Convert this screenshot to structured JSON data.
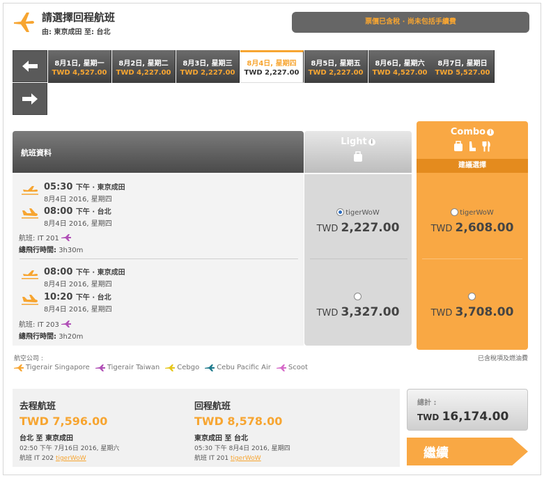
{
  "header": {
    "title": "請選擇回程航班",
    "route": "由: 東京成田 至: 台北",
    "price_note": "票價已含稅 · 尚未包括手續費"
  },
  "dates": [
    {
      "date": "8月1日, 星期一",
      "price": "TWD 4,527.00"
    },
    {
      "date": "8月2日, 星期二",
      "price": "TWD 4,227.00"
    },
    {
      "date": "8月3日, 星期三",
      "price": "TWD 2,227.00"
    },
    {
      "date": "8月4日, 星期四",
      "price": "TWD 2,227.00"
    },
    {
      "date": "8月5日, 星期五",
      "price": "TWD 2,227.00"
    },
    {
      "date": "8月6日, 星期六",
      "price": "TWD 4,527.00"
    },
    {
      "date": "8月7日, 星期日",
      "price": "TWD 5,527.00"
    }
  ],
  "table": {
    "info_header": "航班資料",
    "light_label": "Light",
    "combo_label": "Combo",
    "combo_recommend": "建議選擇",
    "info_icon": "i"
  },
  "flights": [
    {
      "dep_time": "05:30",
      "dep_ampm": "下午 · 東京成田",
      "dep_date": "8月4日 2016, 星期四",
      "arr_time": "08:00",
      "arr_ampm": "下午 · 台北",
      "arr_date": "8月4日 2016, 星期四",
      "flight_label": "航班:",
      "flight_no": "IT 201",
      "duration_label": "總飛行時間:",
      "duration": "3h30m",
      "light": {
        "tag": "tigerWoW",
        "currency": "TWD",
        "amount": "2,227.00",
        "selected": true
      },
      "combo": {
        "tag": "tigerWoW",
        "currency": "TWD",
        "amount": "2,608.00",
        "selected": false
      }
    },
    {
      "dep_time": "08:00",
      "dep_ampm": "下午 · 東京成田",
      "dep_date": "8月4日 2016, 星期四",
      "arr_time": "10:20",
      "arr_ampm": "下午 · 台北",
      "arr_date": "8月4日 2016, 星期四",
      "flight_label": "航班:",
      "flight_no": "IT 203",
      "duration_label": "總飛行時間:",
      "duration": "3h20m",
      "light": {
        "tag": "",
        "currency": "TWD",
        "amount": "3,327.00",
        "selected": false
      },
      "combo": {
        "tag": "",
        "currency": "TWD",
        "amount": "3,708.00",
        "selected": false
      }
    }
  ],
  "airlines_label": "航空公司 :",
  "airlines": [
    {
      "name": "Tigerair Singapore",
      "color": "#f7a531"
    },
    {
      "name": "Tigerair Taiwan",
      "color": "#b04fb6"
    },
    {
      "name": "Cebgo",
      "color": "#e6c619"
    },
    {
      "name": "Cebu Pacific Air",
      "color": "#1e7a8c"
    },
    {
      "name": "Scoot",
      "color": "#d56ac8"
    }
  ],
  "tax_note": "已含稅項及燃油費",
  "summary": {
    "outbound": {
      "label": "去程航班",
      "price": "TWD 7,596.00",
      "route": "台北 至 東京成田",
      "time": "02:50 下午 7月16日 2016, 星期六",
      "flight": "航班 IT 202",
      "tag": "tigerWoW"
    },
    "inbound": {
      "label": "回程航班",
      "price": "TWD 8,578.00",
      "route": "東京成田 至 台北",
      "time": "05:30 下午 8月4日 2016, 星期四",
      "flight": "航班 IT 201",
      "tag": "tigerWoW"
    },
    "total_label": "總計 :",
    "total_currency": "TWD",
    "total_amount": "16,174.00",
    "continue_label": "繼續"
  },
  "colors": {
    "accent": "#f7a531",
    "combo": "#f9a844",
    "dark": "#4a4a4a"
  }
}
